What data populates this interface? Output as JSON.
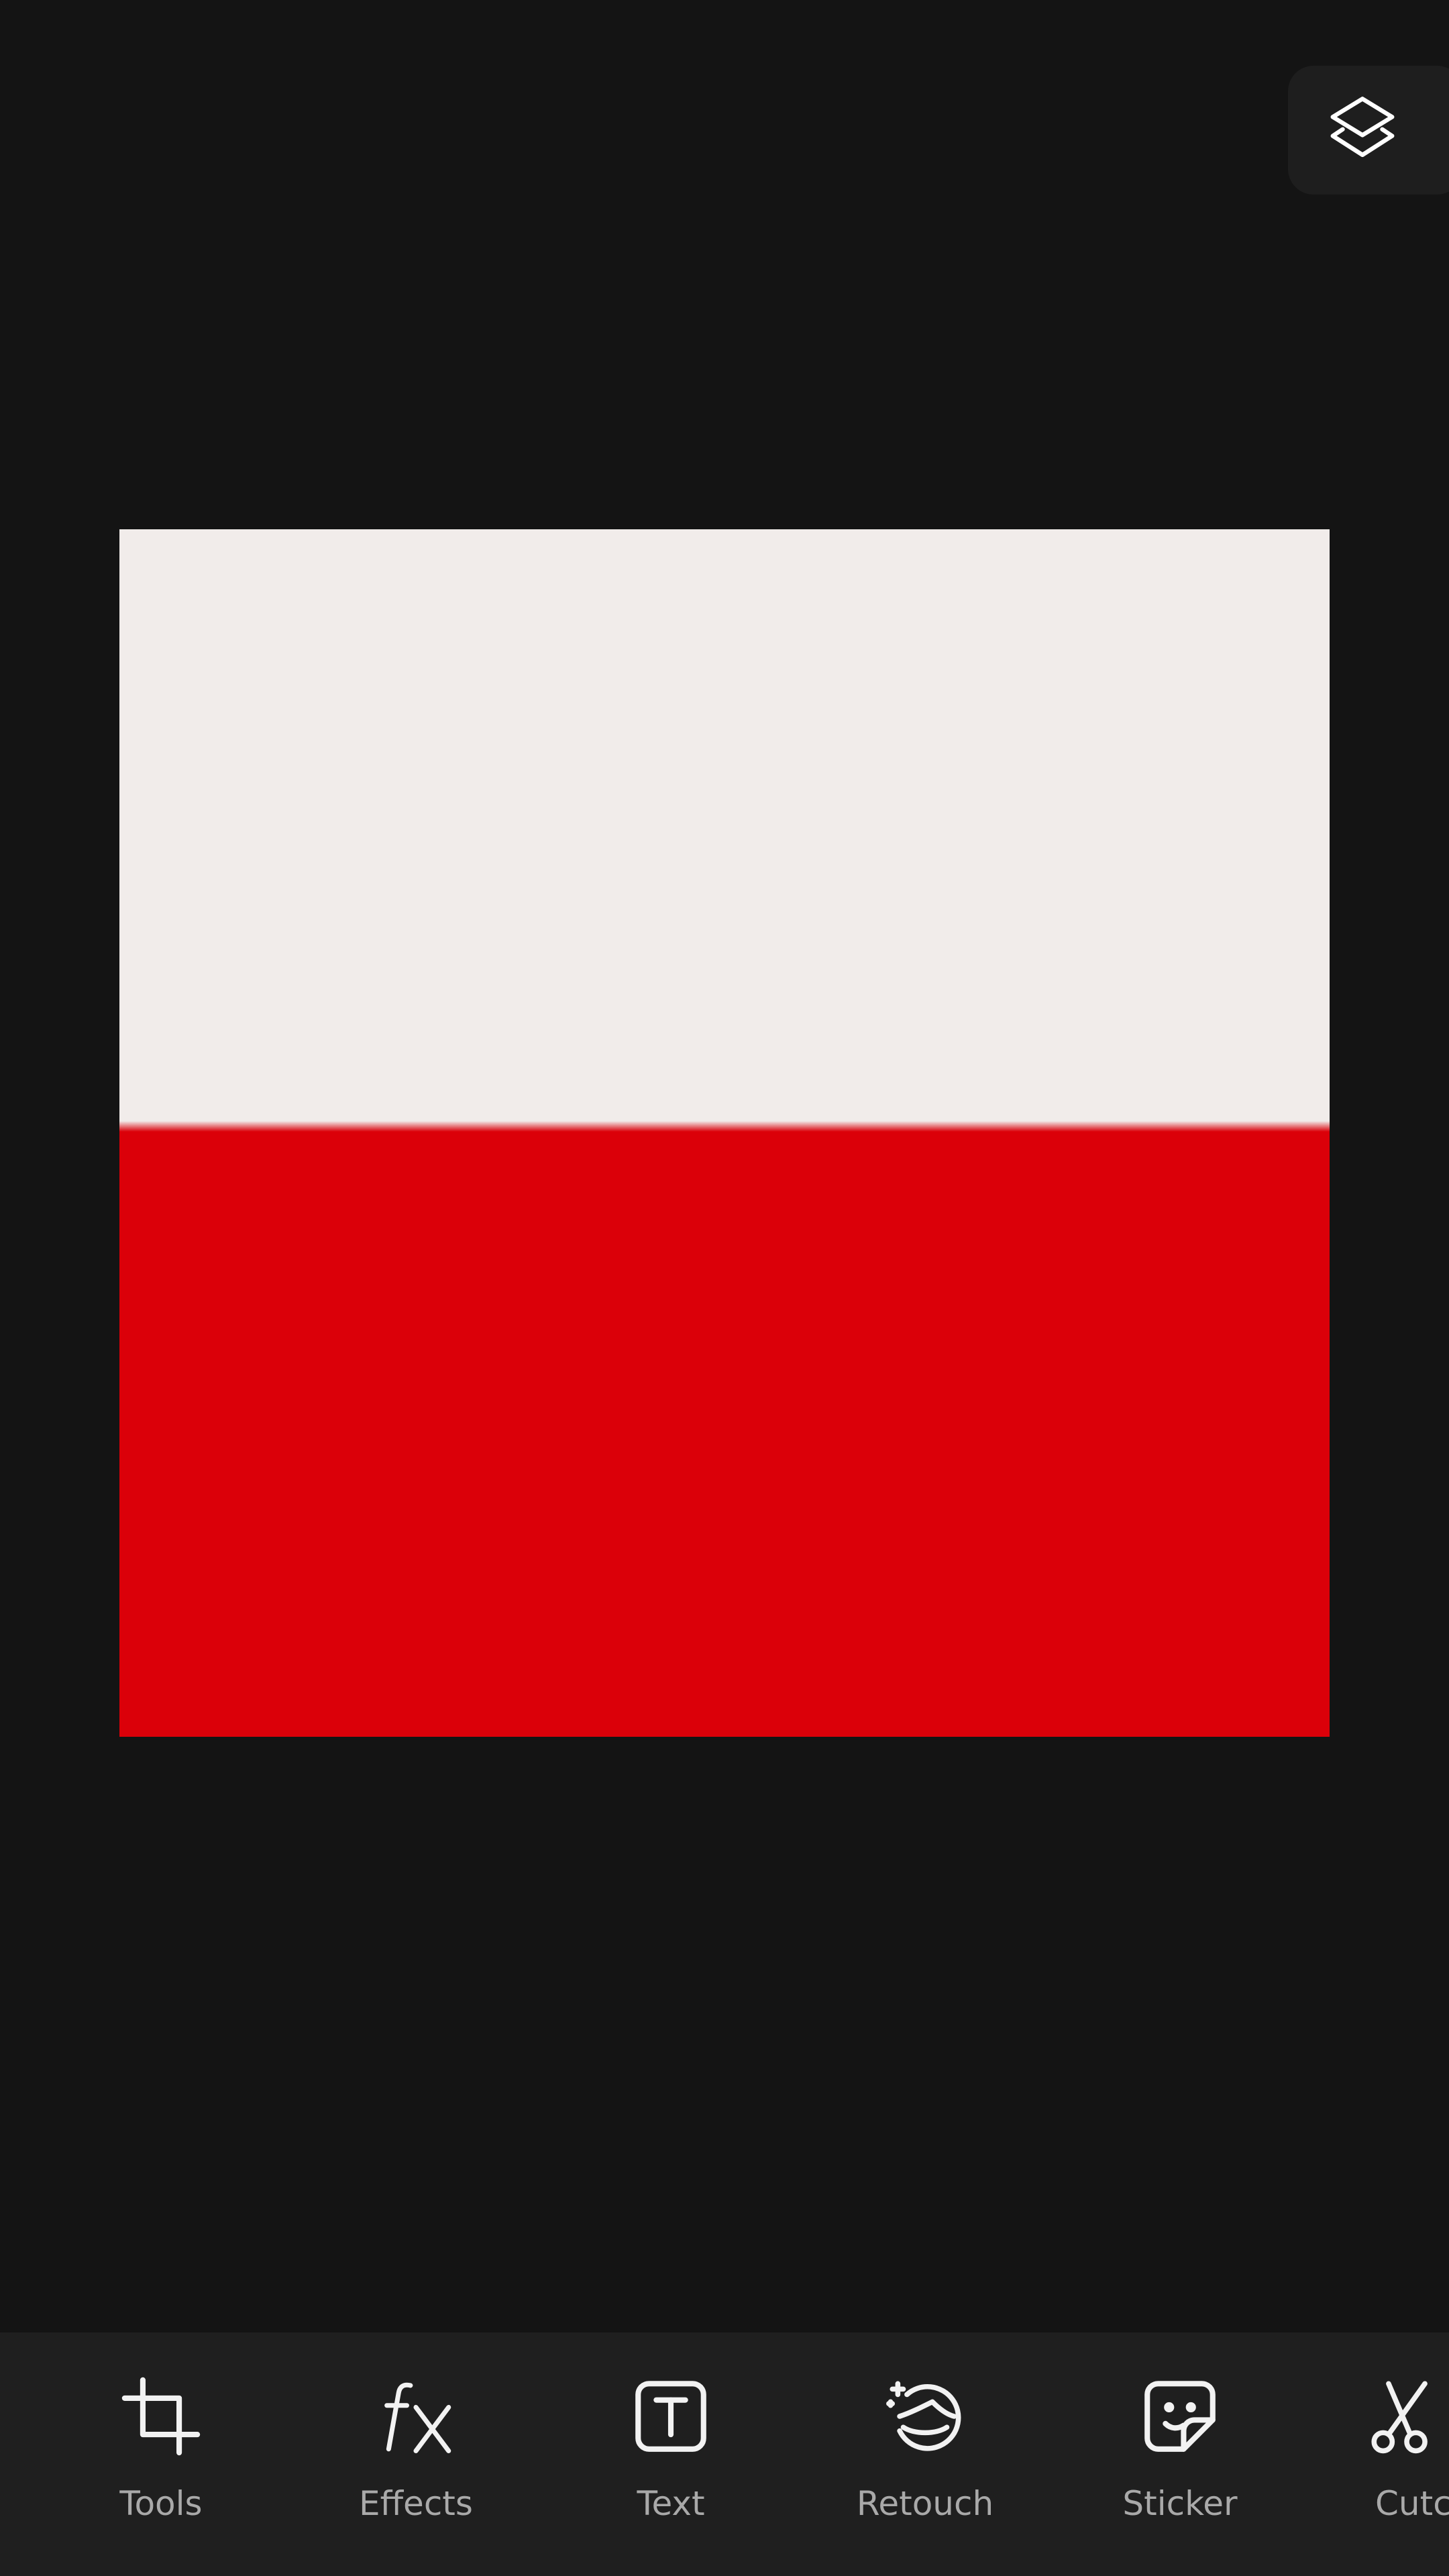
{
  "header": {
    "layers_icon": "layers-icon"
  },
  "canvas": {
    "colors": {
      "top": "#f1ecea",
      "bottom": "#db0009"
    }
  },
  "toolbar": {
    "items": [
      {
        "label": "Tools",
        "icon": "crop-icon"
      },
      {
        "label": "Effects",
        "icon": "fx-icon"
      },
      {
        "label": "Text",
        "icon": "text-box-icon"
      },
      {
        "label": "Retouch",
        "icon": "retouch-face-icon"
      },
      {
        "label": "Sticker",
        "icon": "sticker-icon"
      },
      {
        "label": "Cutc",
        "icon": "scissors-icon"
      }
    ]
  }
}
